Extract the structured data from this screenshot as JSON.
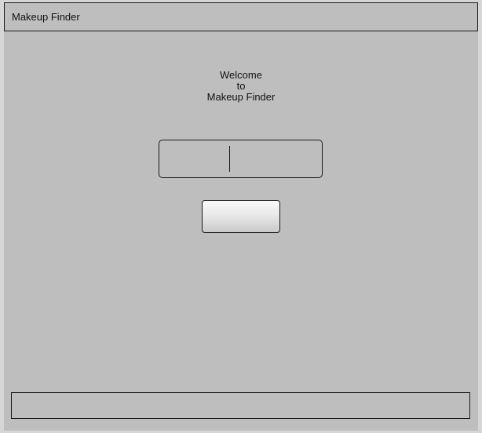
{
  "window": {
    "title": "Makeup Finder"
  },
  "welcome": {
    "line1": "Welcome",
    "line2": "to",
    "line3": "Makeup Finder"
  },
  "search": {
    "value": "",
    "placeholder": ""
  },
  "submit": {
    "label": ""
  },
  "status": {
    "text": ""
  },
  "colors": {
    "window_background": "#bebebe",
    "outer_background": "#d6d6d6",
    "border": "#1a1a1a"
  }
}
